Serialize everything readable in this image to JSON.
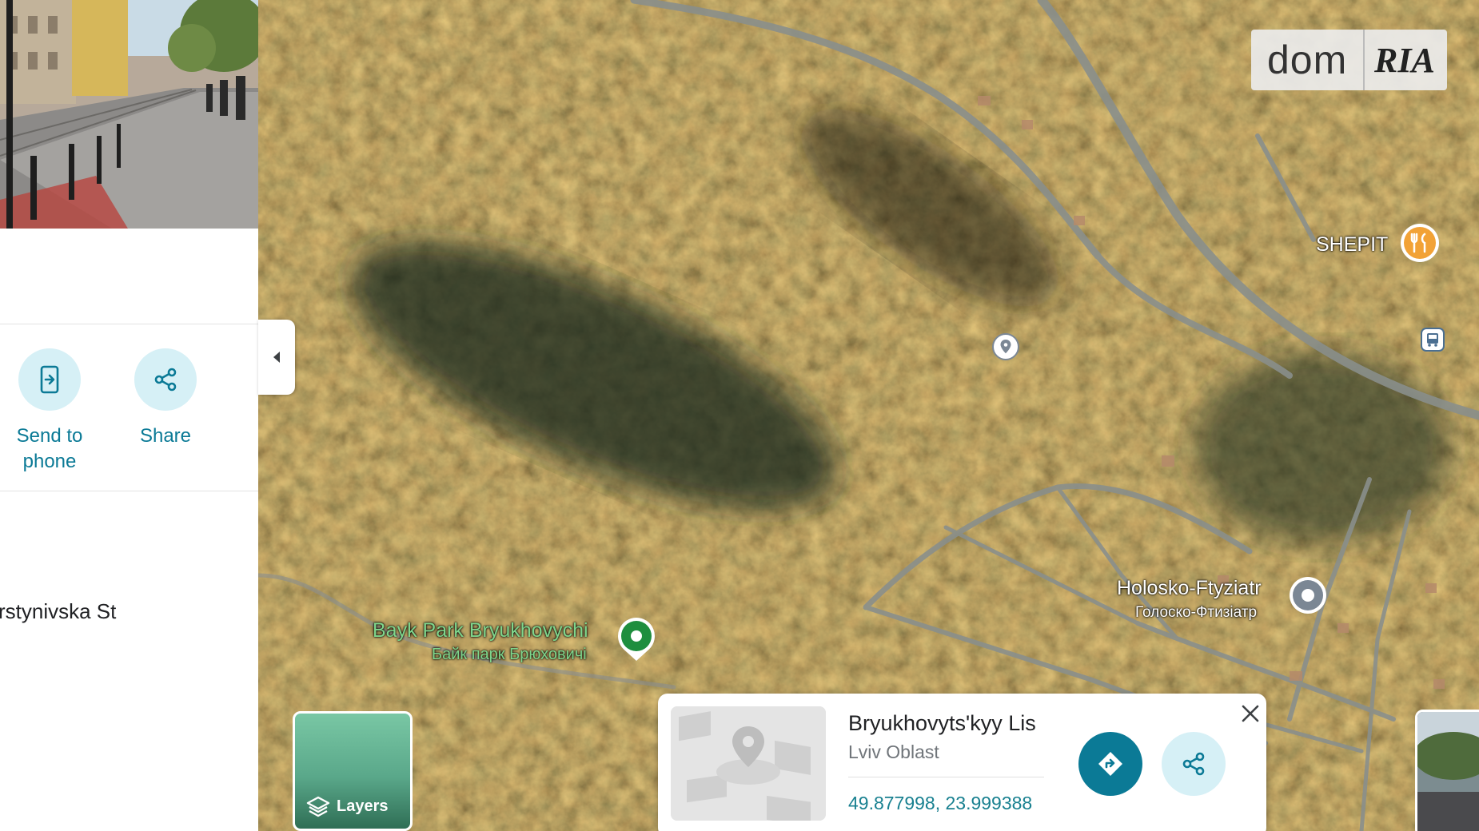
{
  "left_panel": {
    "actions": [
      {
        "label_line1": "Send to",
        "label_line2": "phone",
        "icon": "send-to-phone-icon"
      },
      {
        "label_line1": "Share",
        "label_line2": "",
        "icon": "share-icon"
      }
    ],
    "address_fragment": "rstynivska St",
    "collapse_icon": "chevron-left-icon"
  },
  "map": {
    "watermark": {
      "left": "dom",
      "right": "RIA"
    },
    "places": [
      {
        "name": "SHEPIT",
        "icon": "restaurant-icon",
        "pin_color": "#f2a236"
      },
      {
        "name": "Holosko-Ftyziatr",
        "alt_name": "Голоско-Фтизіатр",
        "icon": "place-pin-icon",
        "pin_color": "#7b8794"
      },
      {
        "name": "Bayk Park Bryukhovychi",
        "alt_name": "Байк парк Брюховичі",
        "icon": "park-pin-icon",
        "pin_color": "#1e8e3e",
        "label_color": "#7fd68c"
      }
    ],
    "layers_label": "Layers",
    "layers_icon": "layers-icon",
    "bus_stop_icon": "bus-stop-icon",
    "dropped_pin_icon": "dropped-pin-icon"
  },
  "info_card": {
    "title": "Bryukhovyts'kyy Lis",
    "subtitle": "Lviv Oblast",
    "coordinates": "49.877998, 23.999388",
    "directions_icon": "directions-icon",
    "share_icon": "share-icon",
    "close_icon": "close-icon"
  },
  "colors": {
    "accent": "#0b7a96",
    "accent_light": "#d6f0f6",
    "coords_text": "#188090"
  }
}
